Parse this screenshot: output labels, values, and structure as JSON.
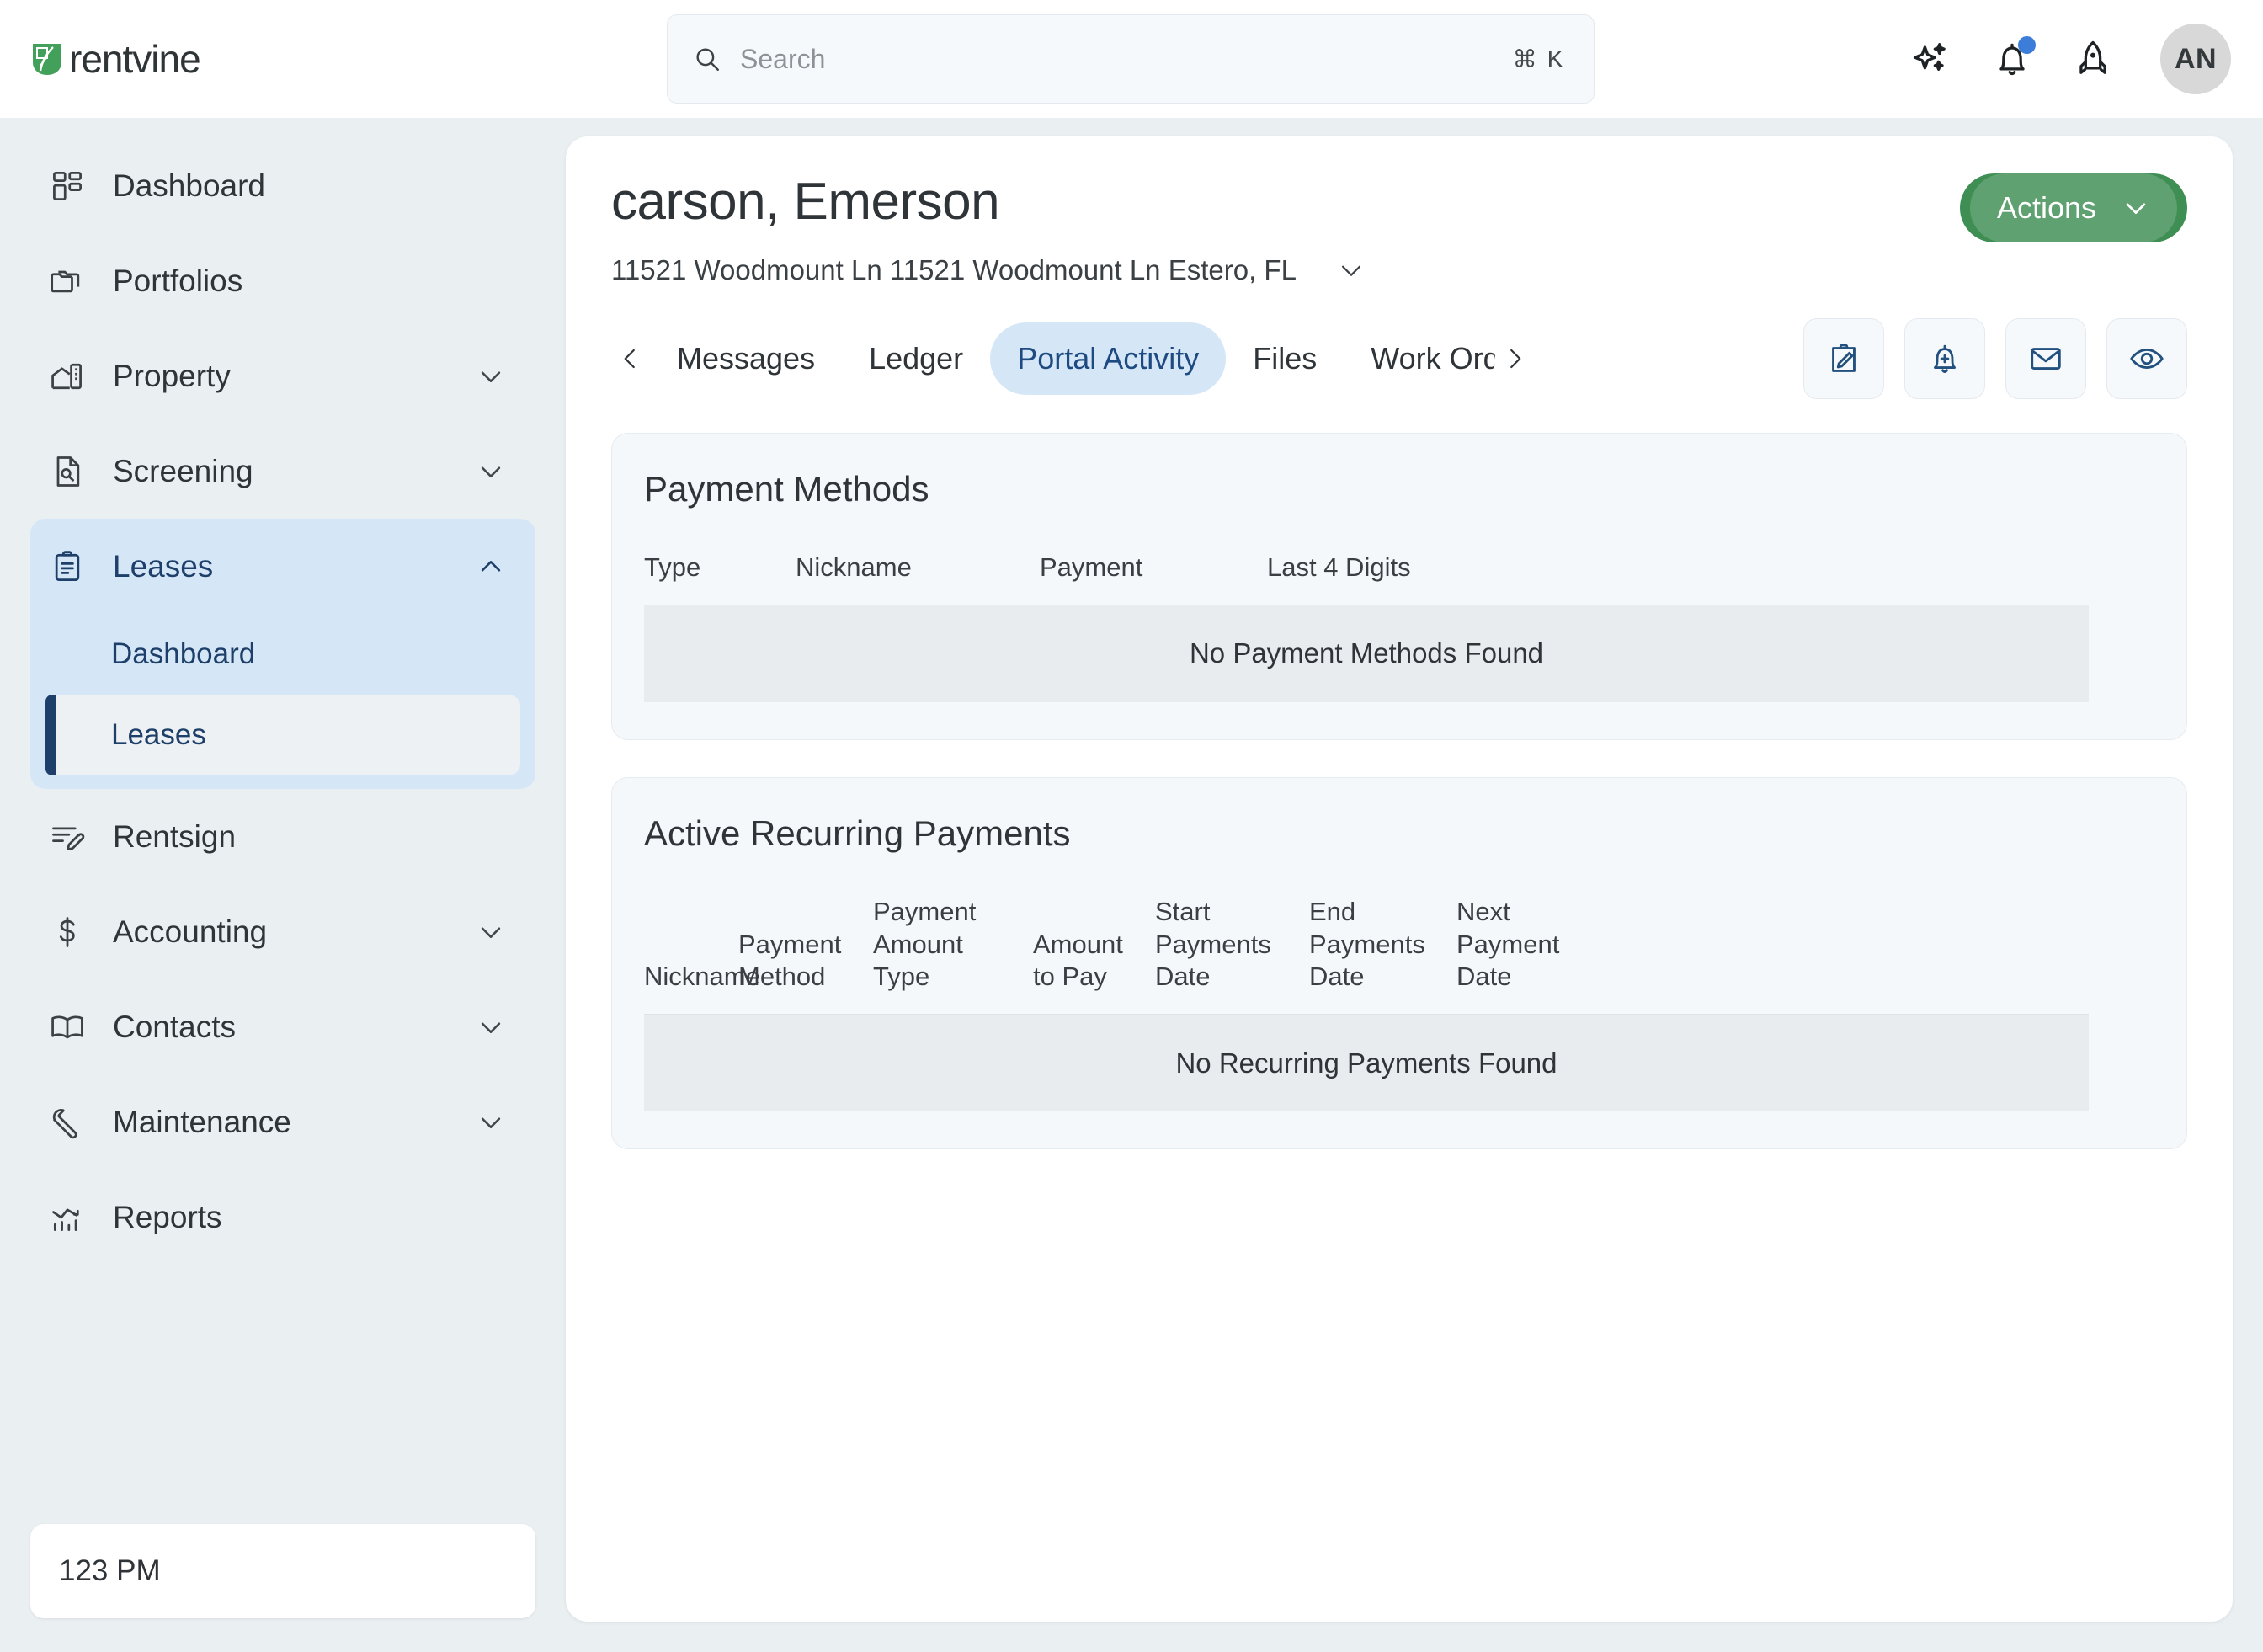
{
  "brand": {
    "name": "rentvine",
    "accent": "#3f8e54"
  },
  "search": {
    "placeholder": "Search",
    "value": "",
    "shortcut": "⌘ K"
  },
  "topbar": {
    "ai_icon": "sparkles-icon",
    "notifications_icon": "bell-icon",
    "whats_new_icon": "rocket-icon",
    "avatar_initials": "AN"
  },
  "sidebar": {
    "items": [
      {
        "label": "Dashboard",
        "icon": "grid-icon",
        "expandable": false
      },
      {
        "label": "Portfolios",
        "icon": "folders-icon",
        "expandable": false
      },
      {
        "label": "Property",
        "icon": "building-icon",
        "expandable": true
      },
      {
        "label": "Screening",
        "icon": "document-search-icon",
        "expandable": true
      },
      {
        "label": "Leases",
        "icon": "clipboard-icon",
        "expandable": true,
        "expanded": true,
        "children": [
          {
            "label": "Dashboard",
            "active": false
          },
          {
            "label": "Leases",
            "active": true
          }
        ]
      },
      {
        "label": "Rentsign",
        "icon": "signature-icon",
        "expandable": false
      },
      {
        "label": "Accounting",
        "icon": "dollar-icon",
        "expandable": true
      },
      {
        "label": "Contacts",
        "icon": "book-icon",
        "expandable": true
      },
      {
        "label": "Maintenance",
        "icon": "wrench-icon",
        "expandable": true
      },
      {
        "label": "Reports",
        "icon": "chart-icon",
        "expandable": false
      }
    ],
    "time_card": "123 PM"
  },
  "page": {
    "title": "carson, Emerson",
    "address": "11521 Woodmount Ln 11521 Woodmount Ln Estero, FL",
    "actions_label": "Actions"
  },
  "tabs": {
    "prev_icon": "chevron-left-icon",
    "next_icon": "chevron-right-icon",
    "items": [
      {
        "label": "Messages",
        "active": false
      },
      {
        "label": "Ledger",
        "active": false
      },
      {
        "label": "Portal Activity",
        "active": true
      },
      {
        "label": "Files",
        "active": false
      },
      {
        "label": "Work Orde",
        "active": false,
        "truncated": true
      }
    ],
    "action_buttons": [
      {
        "icon": "clipboard-edit-icon",
        "name": "edit-note-button"
      },
      {
        "icon": "bell-plus-icon",
        "name": "add-reminder-button"
      },
      {
        "icon": "envelope-icon",
        "name": "email-button"
      },
      {
        "icon": "eye-icon",
        "name": "view-as-button"
      }
    ]
  },
  "payment_methods": {
    "title": "Payment Methods",
    "columns": [
      "Type",
      "Nickname",
      "Payment",
      "Last 4 Digits"
    ],
    "rows": [],
    "empty_text": "No Payment Methods Found"
  },
  "recurring_payments": {
    "title": "Active Recurring Payments",
    "columns": [
      "Nickname",
      "Payment Method",
      "Payment Amount Type",
      "Amount to Pay",
      "Start Payments Date",
      "End Payments Date",
      "Next Payment Date"
    ],
    "rows": [],
    "empty_text": "No Recurring Payments Found"
  }
}
